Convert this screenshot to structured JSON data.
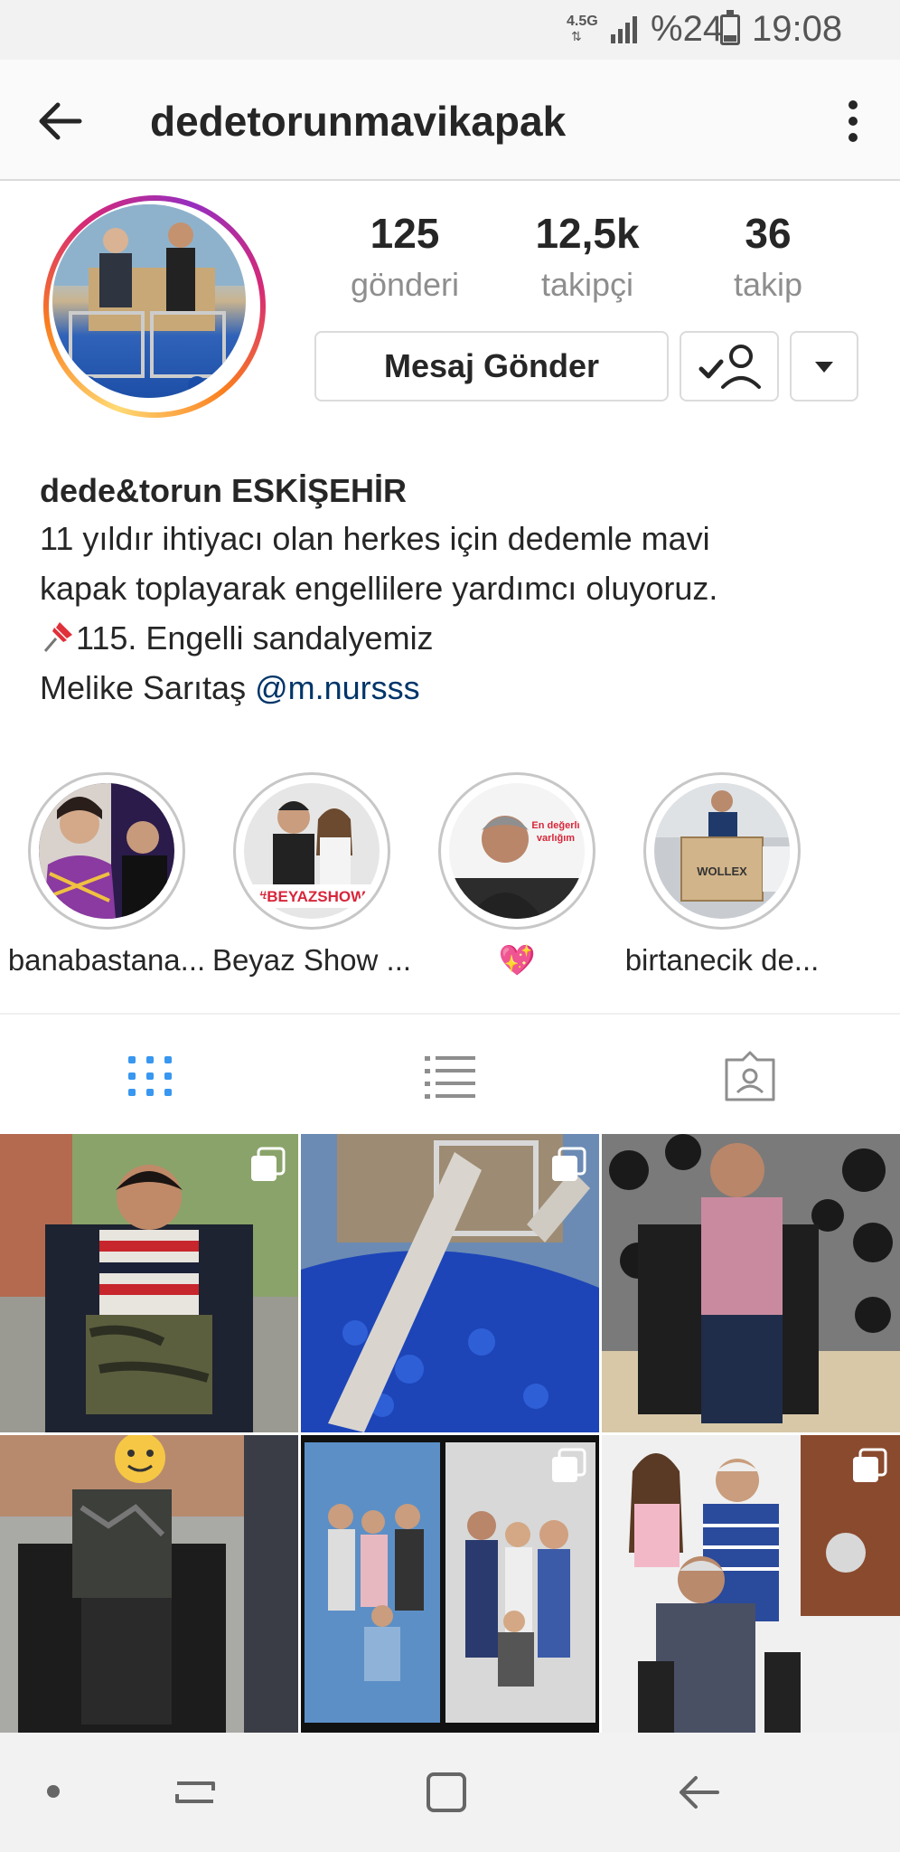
{
  "status_bar": {
    "network": "4.5G",
    "battery_percent": "%24",
    "battery_level": 0.24,
    "time": "19:08"
  },
  "header": {
    "username": "dedetorunmavikapak",
    "back_icon": "arrow-left-icon",
    "more_icon": "more-vertical-icon"
  },
  "profile": {
    "stats": [
      {
        "value": "125",
        "label": "gönderi"
      },
      {
        "value": "12,5k",
        "label": "takipçi"
      },
      {
        "value": "36",
        "label": "takip"
      }
    ],
    "message_button": "Mesaj Gönder",
    "following_icon": "person-check-icon",
    "dropdown_icon": "caret-down-icon"
  },
  "bio": {
    "name": "dede&torun ESKİŞEHİR",
    "line1": "11 yıldır ihtiyacı olan herkes için dedemle mavi",
    "line2": "kapak toplayarak engellilere yardımcı oluyoruz.",
    "line3_emoji": "pushpin-icon",
    "line3": "115. Engelli sandalyemiz",
    "line4_text": "Melike Sarıtaş ",
    "line4_mention": "@m.nursss"
  },
  "highlights": [
    {
      "label": "banabastana..."
    },
    {
      "label": "Beyaz Show ..."
    },
    {
      "label": "💖",
      "overlay_text": "En değerli varlığım"
    },
    {
      "label": "birtanecik de..."
    }
  ],
  "highlight_badges": {
    "beyaz": "#BEYAZSHOW",
    "box": "WOLLEX"
  },
  "tabs": [
    {
      "name": "grid-icon",
      "active": true
    },
    {
      "name": "list-icon",
      "active": false
    },
    {
      "name": "tagged-icon",
      "active": false
    }
  ],
  "colors": {
    "accent_blue": "#3897f0",
    "mention": "#003569",
    "text": "#262626",
    "muted": "#8e8e8e"
  },
  "nav_bar": {
    "icons": [
      "dot-icon",
      "recent-apps-icon",
      "home-icon",
      "back-icon"
    ]
  }
}
